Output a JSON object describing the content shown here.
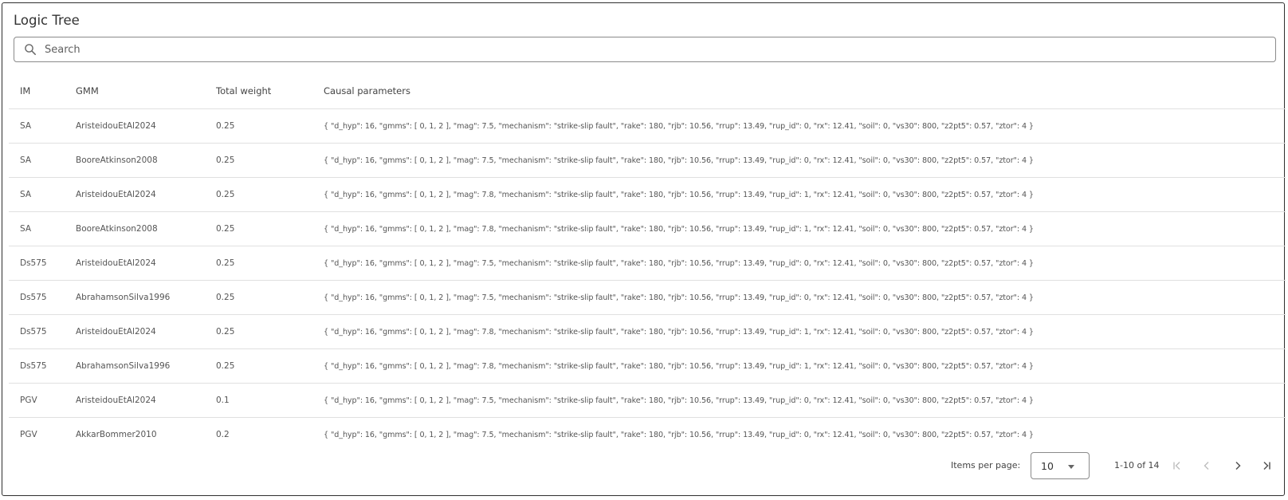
{
  "panel": {
    "title": "Logic Tree",
    "search": {
      "placeholder": "Search",
      "value": ""
    }
  },
  "table": {
    "columns": [
      "IM",
      "GMM",
      "Total weight",
      "Causal parameters"
    ],
    "rows": [
      [
        "SA",
        "AristeidouEtAl2024",
        "0.25",
        "{ \"d_hyp\": 16, \"gmms\": [ 0, 1, 2 ], \"mag\": 7.5, \"mechanism\": \"strike-slip fault\", \"rake\": 180, \"rjb\": 10.56, \"rrup\": 13.49, \"rup_id\": 0, \"rx\": 12.41, \"soil\": 0, \"vs30\": 800, \"z2pt5\": 0.57, \"ztor\": 4 }"
      ],
      [
        "SA",
        "BooreAtkinson2008",
        "0.25",
        "{ \"d_hyp\": 16, \"gmms\": [ 0, 1, 2 ], \"mag\": 7.5, \"mechanism\": \"strike-slip fault\", \"rake\": 180, \"rjb\": 10.56, \"rrup\": 13.49, \"rup_id\": 0, \"rx\": 12.41, \"soil\": 0, \"vs30\": 800, \"z2pt5\": 0.57, \"ztor\": 4 }"
      ],
      [
        "SA",
        "AristeidouEtAl2024",
        "0.25",
        "{ \"d_hyp\": 16, \"gmms\": [ 0, 1, 2 ], \"mag\": 7.8, \"mechanism\": \"strike-slip fault\", \"rake\": 180, \"rjb\": 10.56, \"rrup\": 13.49, \"rup_id\": 1, \"rx\": 12.41, \"soil\": 0, \"vs30\": 800, \"z2pt5\": 0.57, \"ztor\": 4 }"
      ],
      [
        "SA",
        "BooreAtkinson2008",
        "0.25",
        "{ \"d_hyp\": 16, \"gmms\": [ 0, 1, 2 ], \"mag\": 7.8, \"mechanism\": \"strike-slip fault\", \"rake\": 180, \"rjb\": 10.56, \"rrup\": 13.49, \"rup_id\": 1, \"rx\": 12.41, \"soil\": 0, \"vs30\": 800, \"z2pt5\": 0.57, \"ztor\": 4 }"
      ],
      [
        "Ds575",
        "AristeidouEtAl2024",
        "0.25",
        "{ \"d_hyp\": 16, \"gmms\": [ 0, 1, 2 ], \"mag\": 7.5, \"mechanism\": \"strike-slip fault\", \"rake\": 180, \"rjb\": 10.56, \"rrup\": 13.49, \"rup_id\": 0, \"rx\": 12.41, \"soil\": 0, \"vs30\": 800, \"z2pt5\": 0.57, \"ztor\": 4 }"
      ],
      [
        "Ds575",
        "AbrahamsonSilva1996",
        "0.25",
        "{ \"d_hyp\": 16, \"gmms\": [ 0, 1, 2 ], \"mag\": 7.5, \"mechanism\": \"strike-slip fault\", \"rake\": 180, \"rjb\": 10.56, \"rrup\": 13.49, \"rup_id\": 0, \"rx\": 12.41, \"soil\": 0, \"vs30\": 800, \"z2pt5\": 0.57, \"ztor\": 4 }"
      ],
      [
        "Ds575",
        "AristeidouEtAl2024",
        "0.25",
        "{ \"d_hyp\": 16, \"gmms\": [ 0, 1, 2 ], \"mag\": 7.8, \"mechanism\": \"strike-slip fault\", \"rake\": 180, \"rjb\": 10.56, \"rrup\": 13.49, \"rup_id\": 1, \"rx\": 12.41, \"soil\": 0, \"vs30\": 800, \"z2pt5\": 0.57, \"ztor\": 4 }"
      ],
      [
        "Ds575",
        "AbrahamsonSilva1996",
        "0.25",
        "{ \"d_hyp\": 16, \"gmms\": [ 0, 1, 2 ], \"mag\": 7.8, \"mechanism\": \"strike-slip fault\", \"rake\": 180, \"rjb\": 10.56, \"rrup\": 13.49, \"rup_id\": 1, \"rx\": 12.41, \"soil\": 0, \"vs30\": 800, \"z2pt5\": 0.57, \"ztor\": 4 }"
      ],
      [
        "PGV",
        "AristeidouEtAl2024",
        "0.1",
        "{ \"d_hyp\": 16, \"gmms\": [ 0, 1, 2 ], \"mag\": 7.5, \"mechanism\": \"strike-slip fault\", \"rake\": 180, \"rjb\": 10.56, \"rrup\": 13.49, \"rup_id\": 0, \"rx\": 12.41, \"soil\": 0, \"vs30\": 800, \"z2pt5\": 0.57, \"ztor\": 4 }"
      ],
      [
        "PGV",
        "AkkarBommer2010",
        "0.2",
        "{ \"d_hyp\": 16, \"gmms\": [ 0, 1, 2 ], \"mag\": 7.5, \"mechanism\": \"strike-slip fault\", \"rake\": 180, \"rjb\": 10.56, \"rrup\": 13.49, \"rup_id\": 0, \"rx\": 12.41, \"soil\": 0, \"vs30\": 800, \"z2pt5\": 0.57, \"ztor\": 4 }"
      ]
    ]
  },
  "paginator": {
    "items_per_page_label": "Items per page:",
    "page_size": "10",
    "range_label": "1-10 of 14",
    "icons": [
      "first-page-icon",
      "previous-page-icon",
      "next-page-icon",
      "last-page-icon"
    ]
  },
  "colors": {
    "border": "#2f2f2f",
    "row_divider": "#e0e0e0",
    "text": "#555555",
    "disabled_icon": "#bdbdbd",
    "enabled_icon": "#555555"
  }
}
